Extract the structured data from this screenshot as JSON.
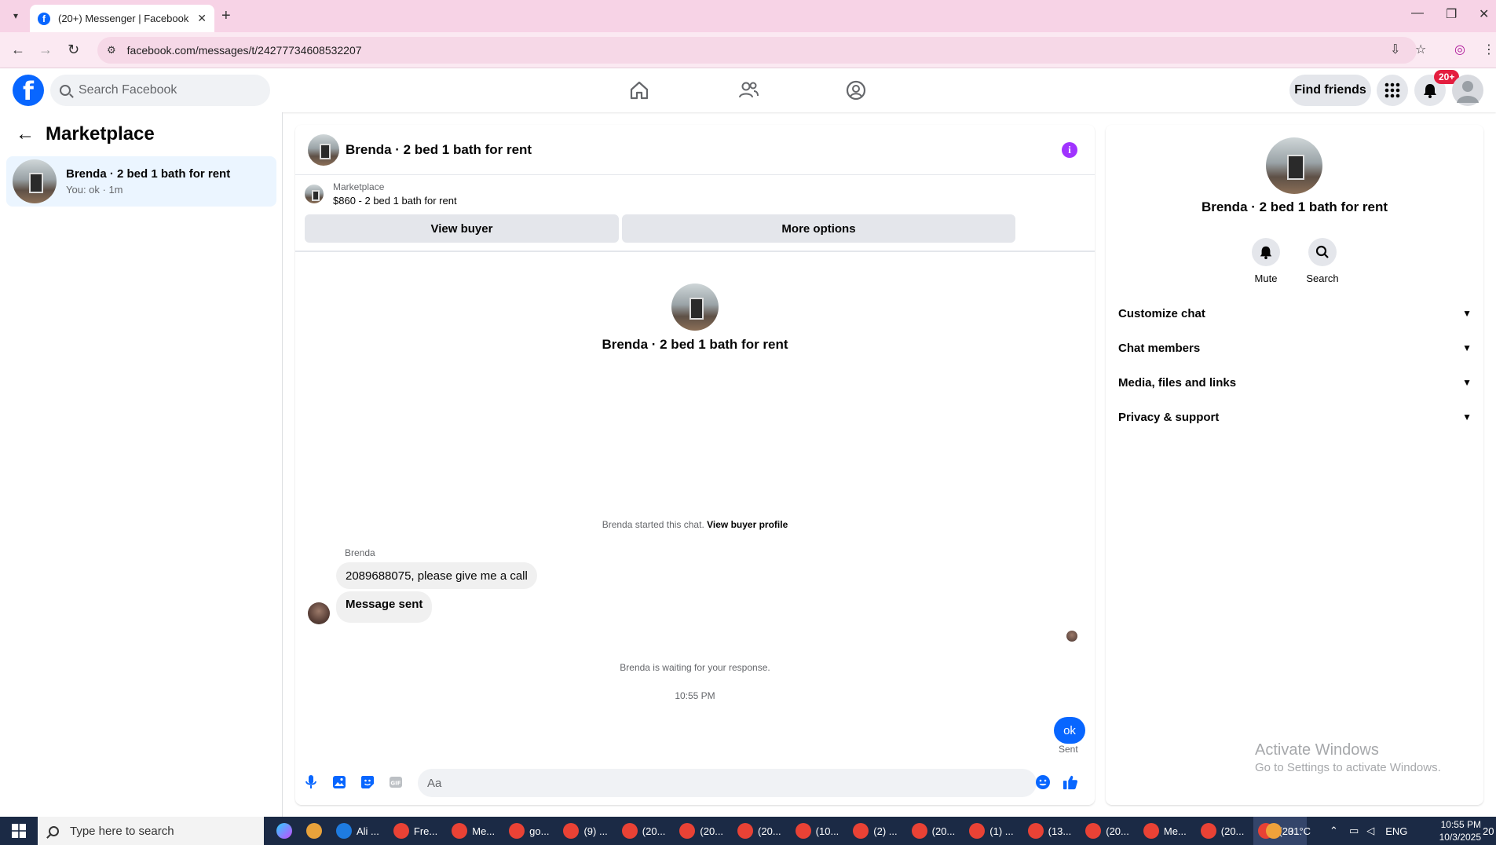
{
  "browser": {
    "tab_title": "(20+) Messenger | Facebook",
    "url": "facebook.com/messages/t/24277734608532207"
  },
  "header": {
    "search_placeholder": "Search Facebook",
    "find_friends": "Find friends",
    "notif_badge": "20+"
  },
  "sidebar": {
    "title": "Marketplace",
    "conversations": [
      {
        "name": "Brenda · 2 bed 1 bath for rent",
        "meta": "You: ok · 1m"
      }
    ]
  },
  "chat": {
    "title": "Brenda · 2 bed 1 bath for rent",
    "marketplace_label": "Marketplace",
    "listing": "$860 - 2 bed 1 bath for rent",
    "view_buyer": "View buyer",
    "more_options": "More options",
    "center_name": "Brenda · 2 bed 1 bath for rent",
    "started_text": "Brenda started this chat.",
    "view_buyer_profile": "View buyer profile",
    "sender": "Brenda",
    "messages_in": [
      "2089688075, please give me a call",
      "Message sent"
    ],
    "waiting": "Brenda is waiting for your response.",
    "time": "10:55 PM",
    "message_out": "ok",
    "sent_label": "Sent",
    "composer_placeholder": "Aa"
  },
  "info_panel": {
    "name": "Brenda · 2 bed 1 bath for rent",
    "mute": "Mute",
    "search": "Search",
    "sections": [
      "Customize chat",
      "Chat members",
      "Media, files and links",
      "Privacy & support"
    ]
  },
  "watermark": {
    "line1": "Activate Windows",
    "line2": "Go to Settings to activate Windows."
  },
  "taskbar": {
    "search_placeholder": "Type here to search",
    "apps": [
      {
        "label": "Ali ...",
        "color": "#1e7be0"
      },
      {
        "label": "Fre...",
        "color": "#e94235"
      },
      {
        "label": "Me...",
        "color": "#e94235"
      },
      {
        "label": "go...",
        "color": "#e94235"
      },
      {
        "label": "(9) ...",
        "color": "#e94235"
      },
      {
        "label": "(20...",
        "color": "#e94235"
      },
      {
        "label": "(20...",
        "color": "#e94235"
      },
      {
        "label": "(20...",
        "color": "#e94235"
      },
      {
        "label": "(10...",
        "color": "#e94235"
      },
      {
        "label": "(2) ...",
        "color": "#e94235"
      },
      {
        "label": "(20...",
        "color": "#e94235"
      },
      {
        "label": "(1) ...",
        "color": "#e94235"
      },
      {
        "label": "(13...",
        "color": "#e94235"
      },
      {
        "label": "(20...",
        "color": "#e94235"
      },
      {
        "label": "Me...",
        "color": "#e94235"
      },
      {
        "label": "(20...",
        "color": "#e94235"
      },
      {
        "label": "(20...",
        "color": "#e94235"
      }
    ],
    "weather": "31°C",
    "lang": "ENG",
    "time": "10:55 PM",
    "date": "10/3/2025",
    "notif_count": "20"
  }
}
